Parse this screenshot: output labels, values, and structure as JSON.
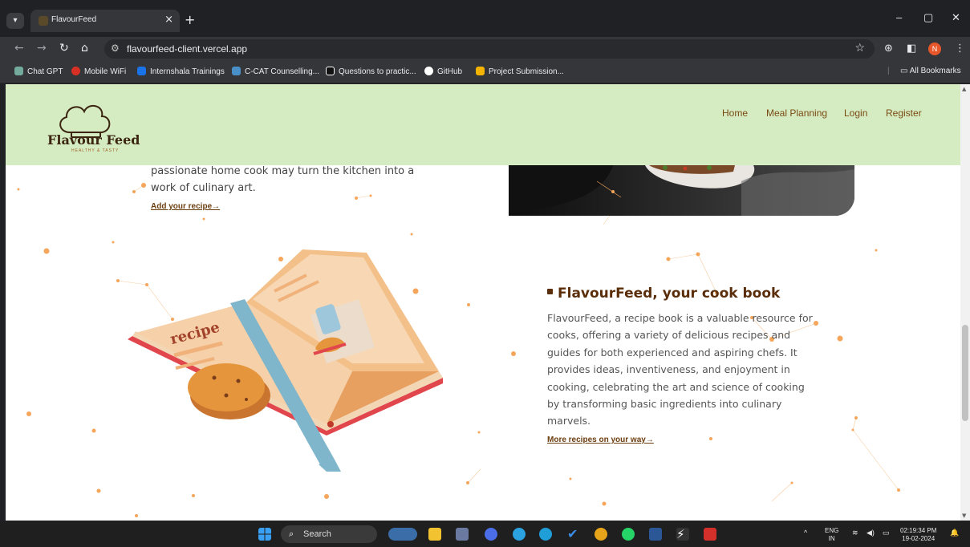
{
  "browser": {
    "tab_title": "FlavourFeed",
    "tab_close": "×",
    "new_tab": "+",
    "url": "flavourfeed-client.vercel.app",
    "profile_initial": "N",
    "window_controls": {
      "minimize": "–",
      "restore": "▢",
      "close": "✕"
    }
  },
  "bookmarks": [
    {
      "label": "Chat GPT",
      "color": "#74aa9c"
    },
    {
      "label": "Mobile WiFi",
      "color": "#d93025"
    },
    {
      "label": "Internshala Trainings",
      "color": "#1a73e8"
    },
    {
      "label": "C-CAT Counselling...",
      "color": "#4a90c8"
    },
    {
      "label": "Questions to practic...",
      "color": "#111111"
    },
    {
      "label": "GitHub",
      "color": "#ffffff"
    },
    {
      "label": "Project Submission...",
      "color": "#f4b400"
    }
  ],
  "all_bookmarks": "All Bookmarks",
  "site": {
    "logo_name": "Flavour Feed",
    "logo_tagline": "HEALTHY & TASTY",
    "nav": {
      "home": "Home",
      "meal_planning": "Meal Planning",
      "login": "Login",
      "register": "Register"
    },
    "hero_text": "passionate home cook may turn the kitchen into a work of culinary art.",
    "add_recipe_link": "Add your recipe→",
    "book_label": "recipe",
    "section_title": "FlavourFeed, your cook book",
    "section_body": "FlavourFeed, a recipe book is a valuable resource for cooks, offering a variety of delicious recipes and guides for both experienced and aspiring chefs. It provides ideas, inventiveness, and enjoyment in cooking, celebrating the art and science of cooking by transforming basic ingredients into culinary marvels.",
    "more_recipes_link": "More recipes on your way→"
  },
  "colors": {
    "header_bg": "#d5ecc2",
    "brand_brown": "#5a2e0a",
    "particle": "#f5a65b"
  },
  "taskbar": {
    "search_label": "Search",
    "lang_top": "ENG",
    "lang_bottom": "IN",
    "time": "02:19:34 PM",
    "date": "19-02-2024"
  }
}
